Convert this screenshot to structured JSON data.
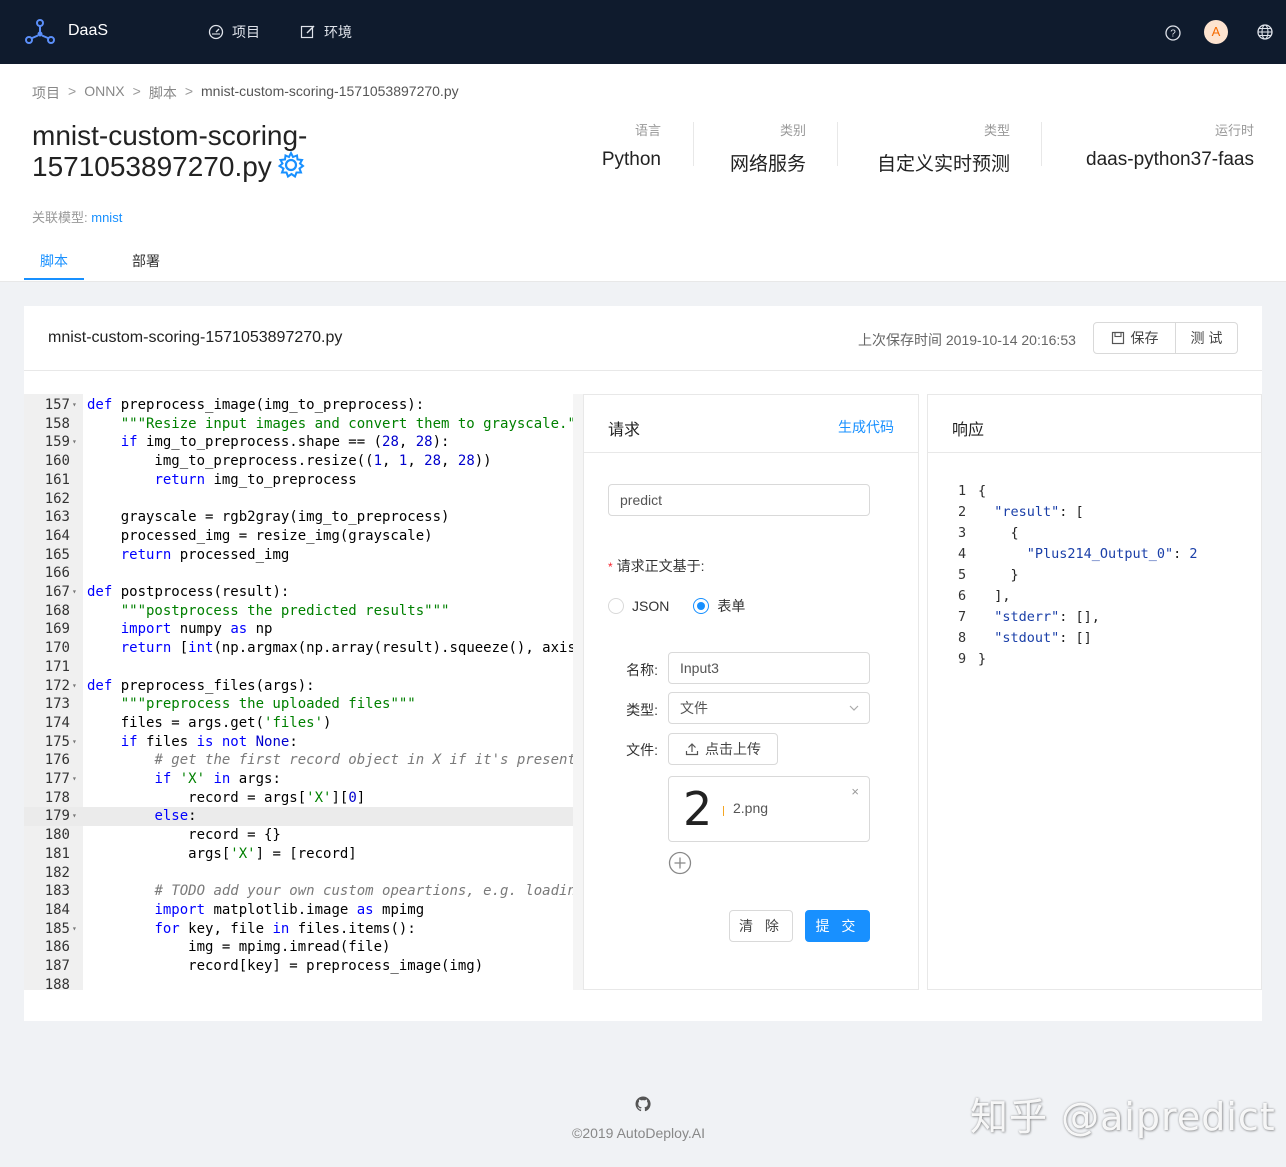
{
  "nav": {
    "brand": "DaaS",
    "items": [
      {
        "label": "项目",
        "icon": "dashboard-icon"
      },
      {
        "label": "环境",
        "icon": "edit-icon"
      }
    ],
    "avatar_letter": "A"
  },
  "breadcrumb": [
    "项目",
    "ONNX",
    "脚本",
    "mnist-custom-scoring-1571053897270.py"
  ],
  "page_title": "mnist-custom-scoring-1571053897270.py",
  "meta": [
    {
      "label": "语言",
      "value": "Python"
    },
    {
      "label": "类别",
      "value": "网络服务"
    },
    {
      "label": "类型",
      "value": "自定义实时预测"
    },
    {
      "label": "运行时",
      "value": "daas-python37-faas"
    }
  ],
  "related": {
    "label": "关联模型:",
    "link": "mnist"
  },
  "tabs": [
    "脚本",
    "部署"
  ],
  "card": {
    "title": "mnist-custom-scoring-1571053897270.py",
    "save_time": "上次保存时间 2019-10-14 20:16:53",
    "save_label": "保存",
    "test_label": "测 试"
  },
  "code_start_line": 157,
  "request": {
    "title": "请求",
    "gen_code": "生成代码",
    "endpoint_value": "predict",
    "body_label": "请求正文基于:",
    "radio_json": "JSON",
    "radio_form": "表单",
    "name_label": "名称:",
    "name_value": "Input3",
    "type_label": "类型:",
    "type_value": "文件",
    "file_label": "文件:",
    "upload_label": "点击上传",
    "file_thumb": "2",
    "file_name": "2.png",
    "clear_label": "清 除",
    "submit_label": "提 交"
  },
  "response": {
    "title": "响应",
    "lines": [
      "{",
      "  \"result\": [",
      "    {",
      "      \"Plus214_Output_0\": 2",
      "    }",
      "  ],",
      "  \"stderr\": [],",
      "  \"stdout\": []",
      "}"
    ]
  },
  "footer": {
    "copyright": "©2019 AutoDeploy.AI",
    "watermark": "知乎 @aipredict"
  }
}
